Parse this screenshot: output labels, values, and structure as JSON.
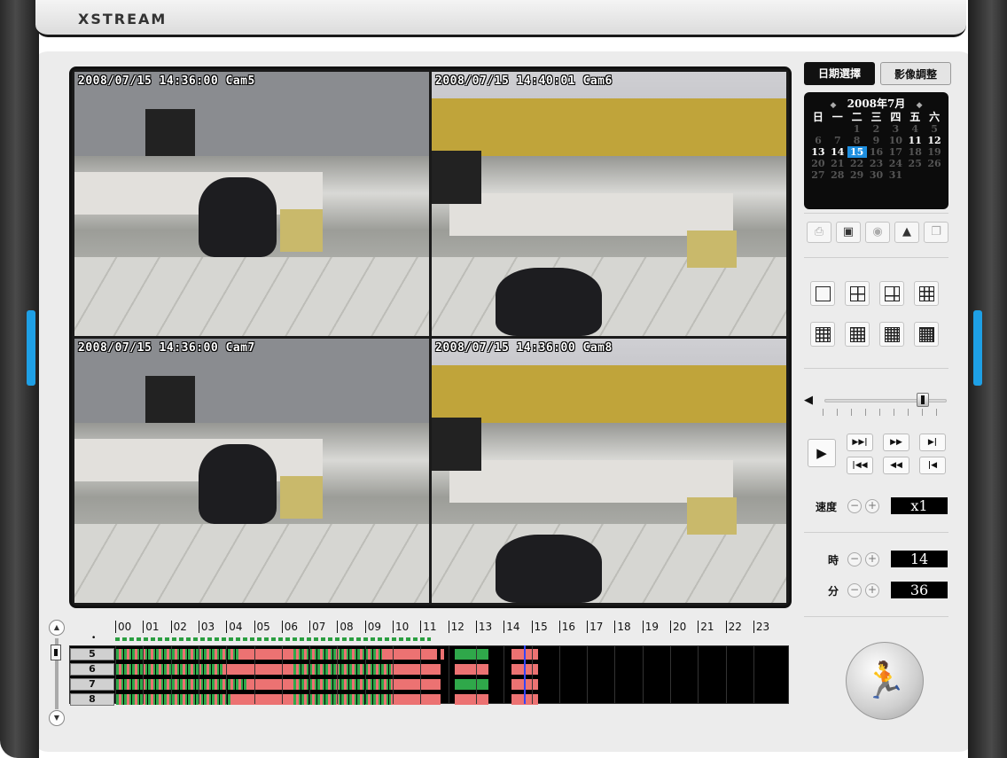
{
  "app": {
    "brand": "XSTREAM"
  },
  "cameras": [
    {
      "overlay": "2008/07/15 14:36:00 Cam5"
    },
    {
      "overlay": "2008/07/15 14:40:01 Cam6"
    },
    {
      "overlay": "2008/07/15 14:36:00 Cam7"
    },
    {
      "overlay": "2008/07/15 14:36:00 Cam8"
    }
  ],
  "tabs": {
    "date_select": "日期選擇",
    "image_adjust": "影像調整"
  },
  "calendar": {
    "title": "2008年7月",
    "weekdays": [
      "日",
      "一",
      "二",
      "三",
      "四",
      "五",
      "六"
    ],
    "selected_day": "15"
  },
  "toolbar": [
    "print-icon",
    "save-icon",
    "snapshot-icon",
    "lock-icon",
    "window-icon"
  ],
  "layouts": [
    "layout-1",
    "layout-4",
    "layout-6",
    "layout-9",
    "layout-10",
    "layout-13",
    "layout-16",
    "layout-25"
  ],
  "volume": {
    "level": 0.8
  },
  "playback": {
    "buttons": [
      "▶▶|",
      "▶▶",
      "▶|",
      "|◀◀",
      "◀◀",
      "|◀"
    ]
  },
  "speed": {
    "label": "速度",
    "value": "x1"
  },
  "time": {
    "hour_label": "時",
    "hour_value": "14",
    "minute_label": "分",
    "minute_value": "36"
  },
  "timeline": {
    "hours": [
      "00",
      "01",
      "02",
      "03",
      "04",
      "05",
      "06",
      "07",
      "08",
      "09",
      "10",
      "11",
      "12",
      "13",
      "14",
      "15",
      "16",
      "17",
      "18",
      "19",
      "20",
      "21",
      "22",
      "23"
    ],
    "channels": [
      "5",
      "6",
      "7",
      "8"
    ],
    "current_time": "14:36"
  },
  "colors": {
    "accent": "#1e8fe0",
    "record_motion": "#2fa84a",
    "record_continuous": "#ec7272",
    "cursor": "#3344ff"
  }
}
